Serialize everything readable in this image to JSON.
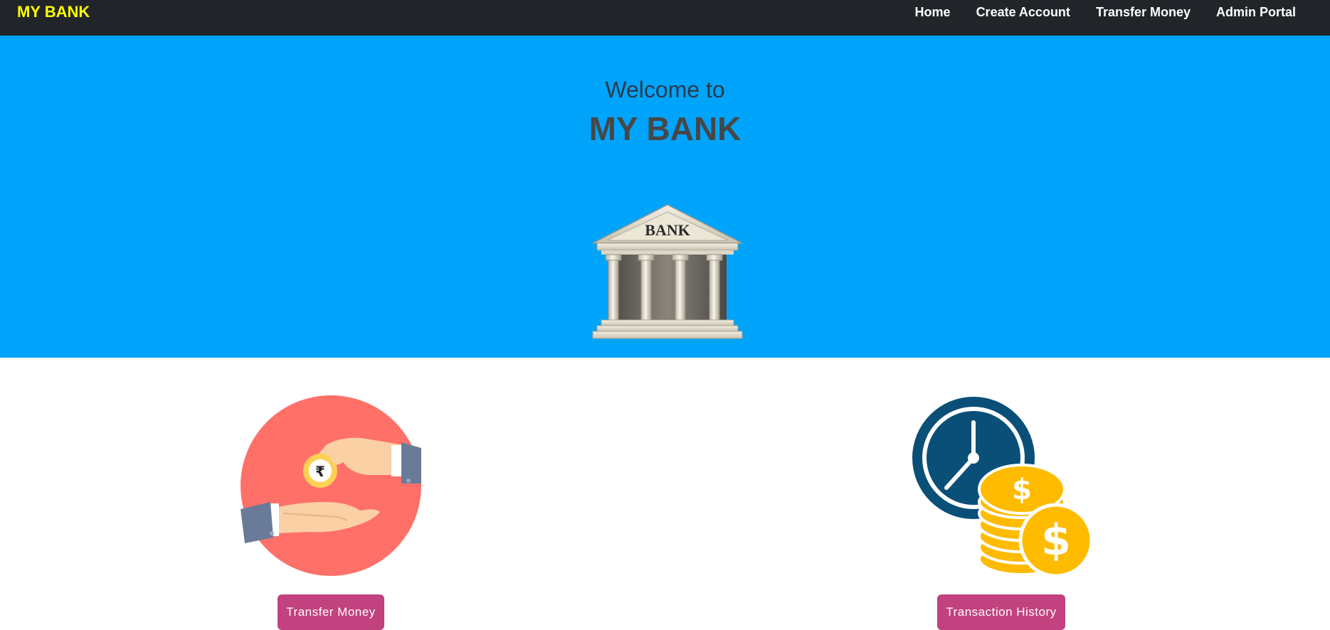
{
  "navbar": {
    "brand": "MY BANK",
    "links": [
      "Home",
      "Create Account",
      "Transfer Money",
      "Admin Portal"
    ]
  },
  "hero": {
    "welcome": "Welcome to",
    "title": "MY BANK",
    "illustration_text": "BANK"
  },
  "features": [
    {
      "button": "Transfer Money",
      "icon": "money-transfer-hands-icon",
      "coin_symbol": "₹"
    },
    {
      "button": "Transaction History",
      "icon": "clock-coins-icon",
      "coin_symbol": "$"
    }
  ],
  "colors": {
    "navbar_bg": "#212529",
    "brand": "#ffff00",
    "hero_bg": "#00a4fa",
    "button_bg": "#c2417f",
    "transfer_circle": "#ff7068",
    "clock_blue": "#0a4f78",
    "coin_gold": "#ffbb00"
  }
}
